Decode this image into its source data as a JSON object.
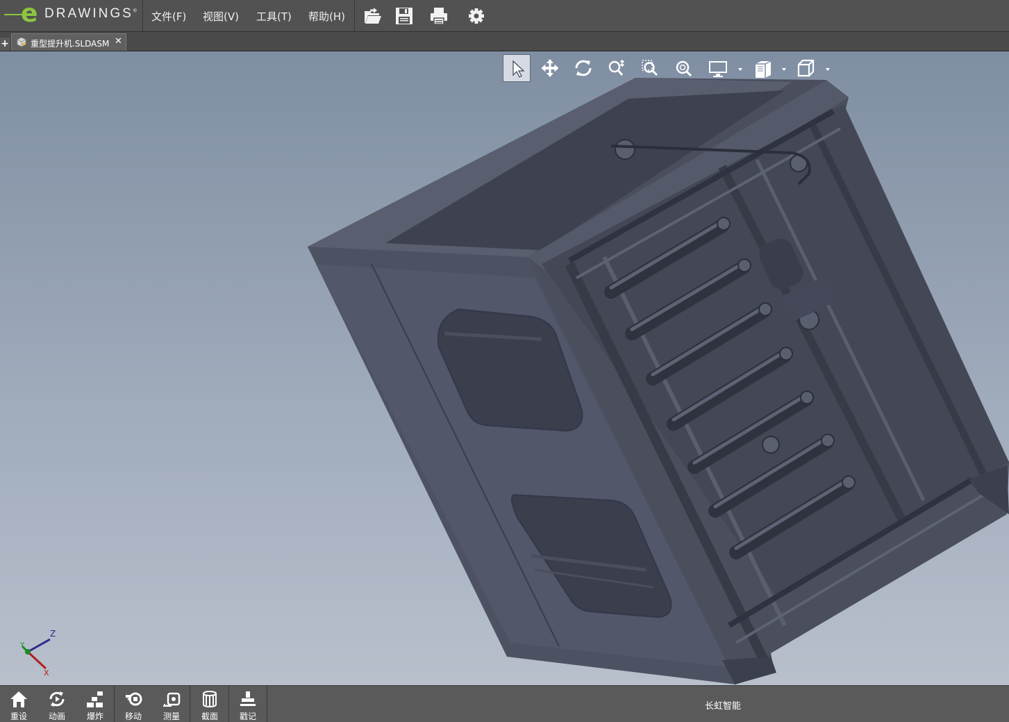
{
  "app": {
    "logo_mark": "e",
    "logo_word": "DRAWINGS",
    "logo_reg": "®"
  },
  "menu": {
    "file": "文件(F)",
    "view": "视图(V)",
    "tools": "工具(T)",
    "help": "帮助(H)"
  },
  "toolbar": {
    "icons": [
      "open-icon",
      "save-icon",
      "print-icon",
      "settings-icon"
    ]
  },
  "tabs": {
    "add": "+",
    "document": "重型提升机.SLDASM",
    "close": "✕"
  },
  "view_toolbar": {
    "icons": [
      "select-icon",
      "pan-icon",
      "rotate-icon",
      "zoom-icon",
      "zoom-area-icon",
      "zoom-fit-icon",
      "display-style-icon",
      "view-orientation-icon",
      "standard-views-icon"
    ],
    "active": "select-icon"
  },
  "triad": {
    "x": "X",
    "y": "Y",
    "z": "Z"
  },
  "bottom_toolbar": {
    "items": [
      "重设",
      "动画",
      "爆炸",
      "移动",
      "测量",
      "截面",
      "戳记"
    ]
  },
  "status": {
    "text": "长虹智能"
  },
  "colors": {
    "accent": "#8cc63f",
    "model": "#4a4e5d",
    "viewport_top": "#7f8ea2",
    "viewport_bottom": "#b8c0cc"
  }
}
